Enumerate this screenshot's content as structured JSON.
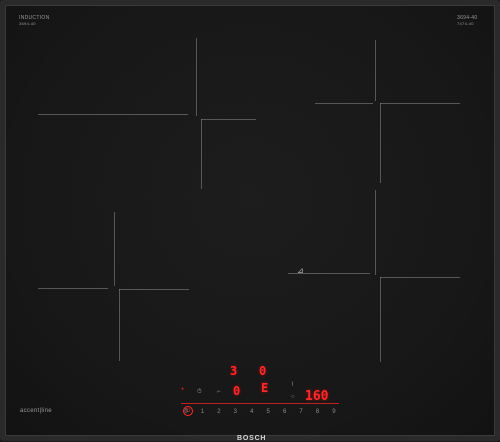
{
  "top_left_label": "INDUCTION",
  "top_left_sub": "3694-40",
  "top_right_label": "3694-40",
  "top_right_sub": "7474-40",
  "bottom_left_label": "accent|line",
  "display_zone_top": "3",
  "display_zone_top_right": "0",
  "display_zone_mid": "0",
  "display_zone_e": "E",
  "display_temp": "160",
  "slider_numbers": [
    "0",
    "1",
    "2",
    "3",
    "4",
    "5",
    "6",
    "7",
    "8",
    "9"
  ],
  "brand": "BOSCH",
  "accent_color": "#ff2a2a"
}
